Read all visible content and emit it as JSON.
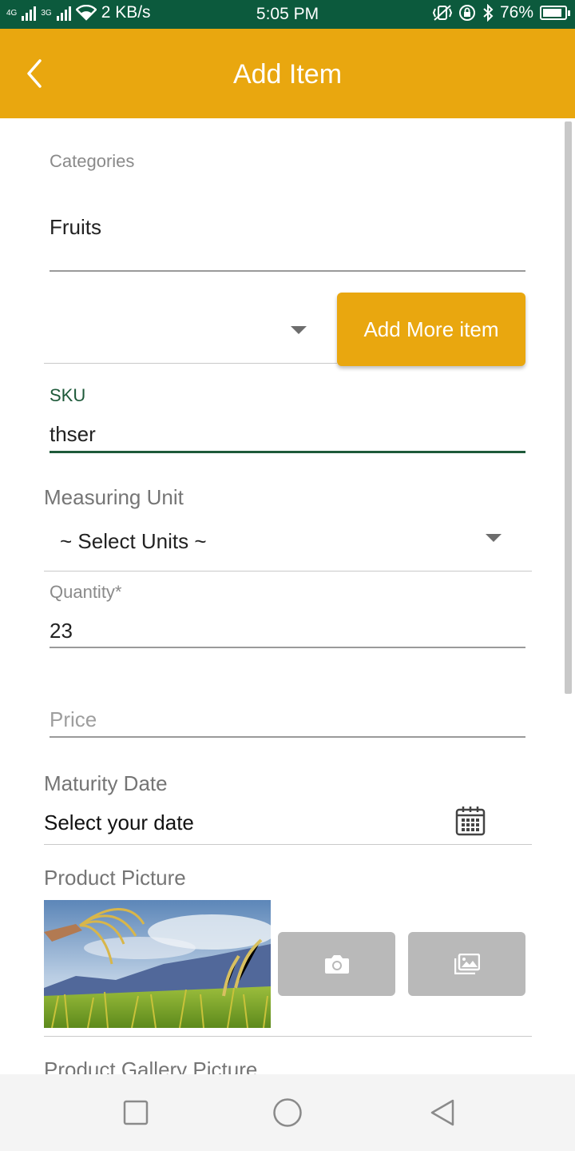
{
  "status_bar": {
    "network_1": "4G",
    "network_2": "3G",
    "speed": "2 KB/s",
    "time": "5:05 PM",
    "battery": "76%",
    "battery_level": 0.76
  },
  "app_bar": {
    "title": "Add Item"
  },
  "form": {
    "categories_label": "Categories",
    "categories_value": "Fruits",
    "add_more_label": "Add More item",
    "sku_label": "SKU",
    "sku_value": "thser",
    "measuring_unit_label": "Measuring Unit",
    "measuring_unit_value": "~ Select Units ~",
    "quantity_label": "Quantity*",
    "quantity_value": "23",
    "price_placeholder": "Price",
    "maturity_label": "Maturity Date",
    "maturity_value": "Select your date",
    "product_picture_label": "Product Picture",
    "gallery_label": "Product Gallery Picture"
  },
  "colors": {
    "status_bar": "#0c5a3d",
    "accent": "#e9a70f",
    "focus": "#1e5a3a"
  }
}
